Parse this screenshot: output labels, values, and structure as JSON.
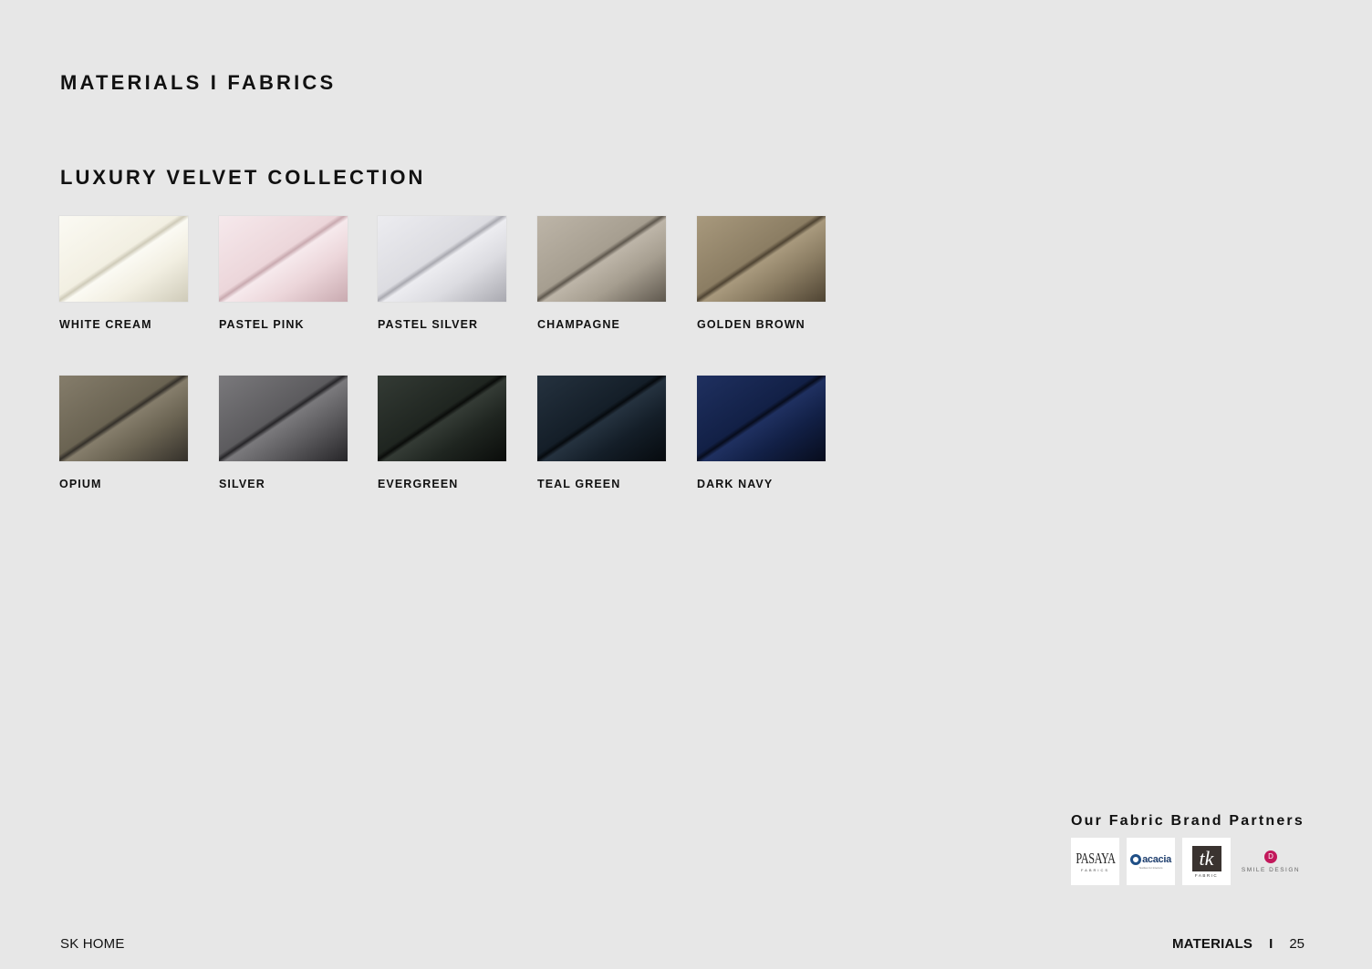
{
  "header": {
    "title": "MATERIALS I FABRICS",
    "collection_title": "LUXURY VELVET COLLECTION"
  },
  "swatches": [
    {
      "label": "WHITE CREAM",
      "color_base": "#f2efe2",
      "color_light": "#fbfaf3",
      "color_dark": "#cfcbb9"
    },
    {
      "label": "PASTEL PINK",
      "color_base": "#ecd6da",
      "color_light": "#f6e9ec",
      "color_dark": "#c9aab0"
    },
    {
      "label": "PASTEL SILVER",
      "color_base": "#dcdce1",
      "color_light": "#ececf0",
      "color_dark": "#a9a9b0"
    },
    {
      "label": "CHAMPAGNE",
      "color_base": "#a69e90",
      "color_light": "#bdb5a8",
      "color_dark": "#5f584e"
    },
    {
      "label": "GOLDEN BROWN",
      "color_base": "#8b7d63",
      "color_light": "#a8997d",
      "color_dark": "#4f4433"
    },
    {
      "label": "OPIUM",
      "color_base": "#6a6352",
      "color_light": "#857d6b",
      "color_dark": "#34302a"
    },
    {
      "label": "SILVER",
      "color_base": "#5c5b5e",
      "color_light": "#7a797c",
      "color_dark": "#262528"
    },
    {
      "label": "EVERGREEN",
      "color_base": "#1f2520",
      "color_light": "#343b35",
      "color_dark": "#0a0c0a"
    },
    {
      "label": "TEAL GREEN",
      "color_base": "#141e28",
      "color_light": "#25323f",
      "color_dark": "#060a0e"
    },
    {
      "label": "DARK NAVY",
      "color_base": "#122046",
      "color_light": "#1f3060",
      "color_dark": "#070c1c"
    }
  ],
  "partners": {
    "title": "Our Fabric Brand Partners",
    "logos": [
      {
        "name": "PASAYA",
        "sub": "FABRICS",
        "icon": "pasaya-logo"
      },
      {
        "name": "acacia",
        "sub": "Textiles for Interiors",
        "icon": "acacia-logo"
      },
      {
        "name": "tk",
        "sub": "FABRIC",
        "icon": "tk-fabric-logo"
      },
      {
        "name": "SMILE DESIGN",
        "mark": "D",
        "icon": "smile-design-logo",
        "accent": "#c2185b"
      }
    ]
  },
  "footer": {
    "brand": "SK HOME",
    "section": "MATERIALS",
    "separator": "I",
    "page_number": "25"
  }
}
